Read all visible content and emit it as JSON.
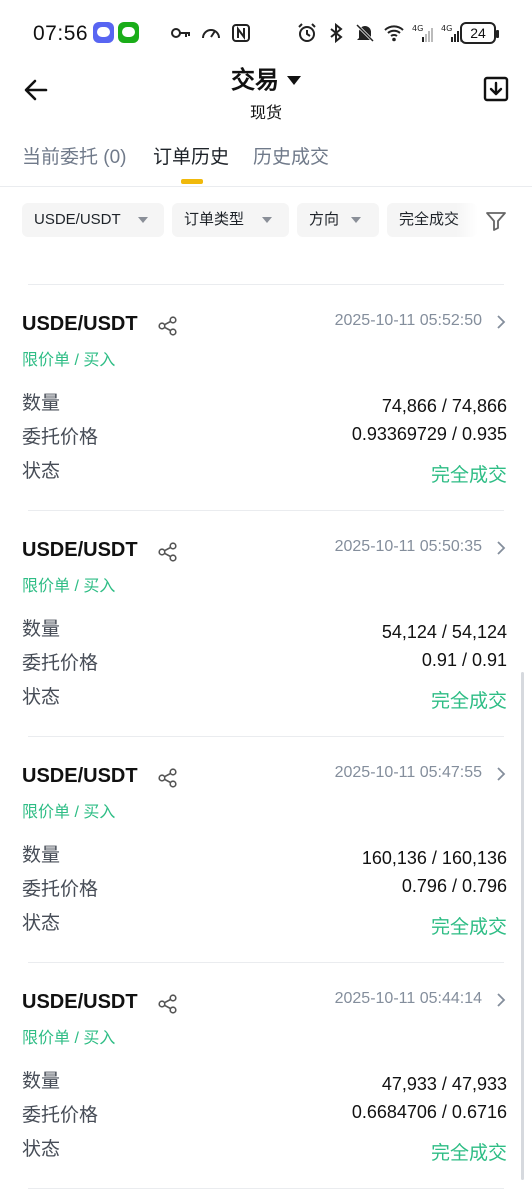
{
  "status_bar": {
    "time": "07:56",
    "battery": "24",
    "app_icons": [
      "discord-icon",
      "wechat-icon"
    ],
    "icons_left": [
      "key-icon",
      "speedometer-icon",
      "nfc-icon"
    ],
    "icons_right": [
      "alarm-icon",
      "bluetooth-icon",
      "mute-icon",
      "wifi-icon",
      "signal-4g-icon",
      "signal-4g-icon"
    ]
  },
  "header": {
    "title": "交易",
    "subtitle": "现货",
    "back_icon": "arrow-left-icon",
    "export_icon": "download-icon"
  },
  "tabs": [
    {
      "label": "当前委托 (0)",
      "active": false
    },
    {
      "label": "订单历史",
      "active": true
    },
    {
      "label": "历史成交",
      "active": false
    }
  ],
  "filters": [
    {
      "label": "USDE/USDT"
    },
    {
      "label": "订单类型"
    },
    {
      "label": "方向"
    },
    {
      "label": "完全成交"
    }
  ],
  "labels": {
    "quantity": "数量",
    "price": "委托价格",
    "status": "状态"
  },
  "orders": [
    {
      "pair": "USDE/USDT",
      "time": "2025-10-11 05:52:50",
      "type": "限价单 / 买入",
      "quantity": "74,866 / 74,866",
      "price": "0.93369729 / 0.935",
      "status": "完全成交"
    },
    {
      "pair": "USDE/USDT",
      "time": "2025-10-11 05:50:35",
      "type": "限价单 / 买入",
      "quantity": "54,124 / 54,124",
      "price": "0.91 / 0.91",
      "status": "完全成交"
    },
    {
      "pair": "USDE/USDT",
      "time": "2025-10-11 05:47:55",
      "type": "限价单 / 买入",
      "quantity": "160,136 / 160,136",
      "price": "0.796 / 0.796",
      "status": "完全成交"
    },
    {
      "pair": "USDE/USDT",
      "time": "2025-10-11 05:44:14",
      "type": "限价单 / 买入",
      "quantity": "47,933 / 47,933",
      "price": "0.6684706 / 0.6716",
      "status": "完全成交"
    }
  ],
  "colors": {
    "accent": "#f0b90b",
    "buy": "#2ebd85",
    "muted": "#848e9c"
  }
}
